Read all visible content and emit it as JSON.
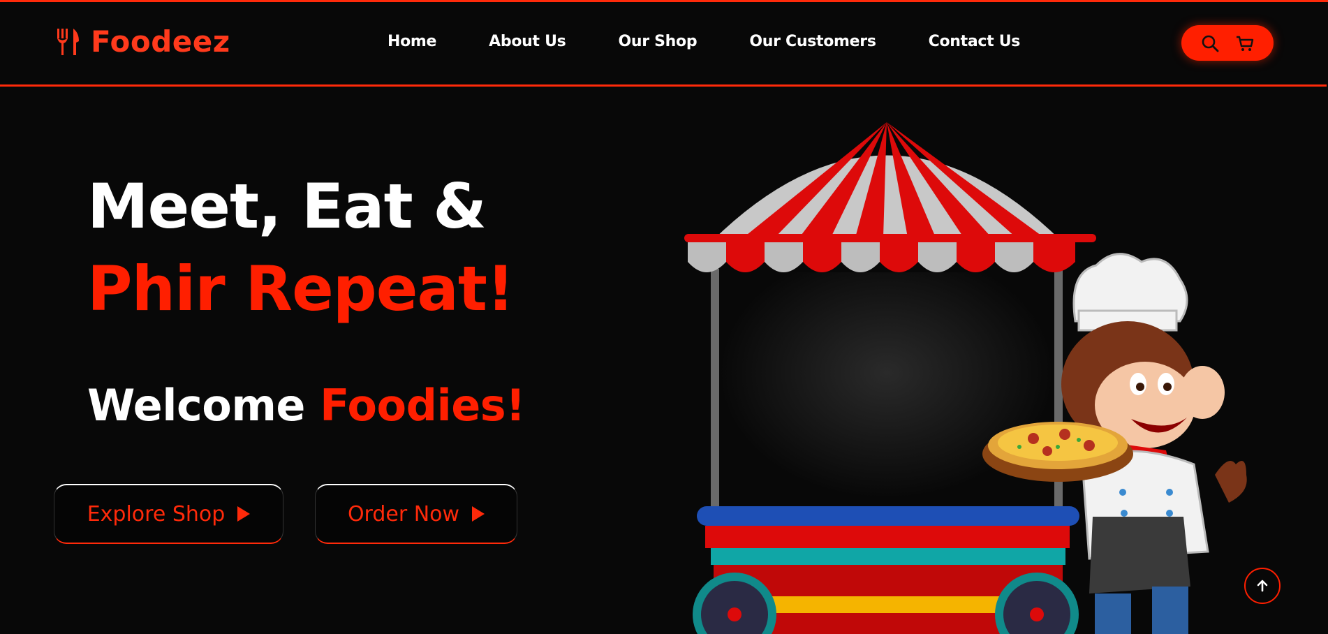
{
  "brand": {
    "name": "Foodeez",
    "icon": "fork-knife-icon",
    "color": "#ff3a1c"
  },
  "nav": {
    "items": [
      {
        "label": "Home"
      },
      {
        "label": "About Us"
      },
      {
        "label": "Our Shop"
      },
      {
        "label": "Our Customers"
      },
      {
        "label": "Contact Us"
      }
    ]
  },
  "header_icons": {
    "search": "search-icon",
    "cart": "cart-icon",
    "background": "#ff1f00"
  },
  "hero": {
    "line1": "Meet, Eat &",
    "line2": "Phir Repeat!",
    "welcome": "Welcome",
    "foodies": "Foodies!",
    "buttons": {
      "explore": "Explore Shop",
      "order": "Order Now"
    }
  },
  "illustration": {
    "name": "food-cart-chef-monkey-illustration"
  },
  "scroll_top": {
    "icon": "arrow-up-icon"
  },
  "colors": {
    "accent": "#ff1f00",
    "background": "#080808",
    "text": "#ffffff"
  }
}
